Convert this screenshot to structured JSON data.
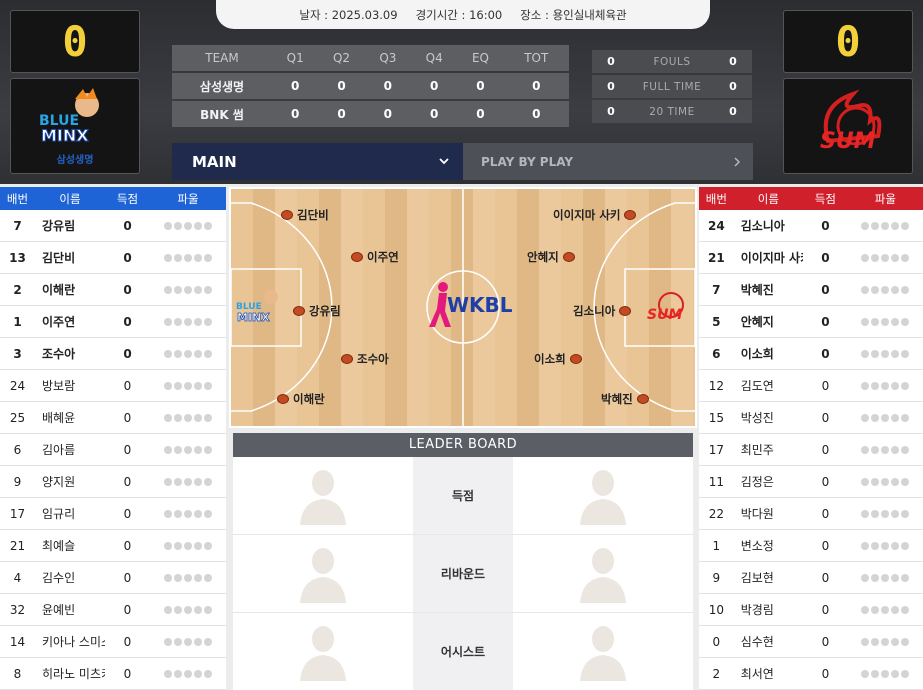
{
  "game_info": {
    "date": "날자 : 2025.03.09",
    "time": "경기시간 : 16:00",
    "venue": "장소 : 용인실내체육관"
  },
  "home": {
    "score": "0",
    "name": "삼성생명",
    "logo_text": "BLUE MINX"
  },
  "away": {
    "score": "0",
    "logo_text": "BNK SUM"
  },
  "quarter_table": {
    "headers": [
      "TEAM",
      "Q1",
      "Q2",
      "Q3",
      "Q4",
      "EQ",
      "TOT"
    ],
    "rows": [
      {
        "team": "삼성생명",
        "scores": [
          "0",
          "0",
          "0",
          "0",
          "0",
          "0"
        ]
      },
      {
        "team": "BNK 썸",
        "scores": [
          "0",
          "0",
          "0",
          "0",
          "0",
          "0"
        ]
      }
    ]
  },
  "stats": [
    {
      "label": "FOULS",
      "home": "0",
      "away": "0"
    },
    {
      "label": "FULL TIME",
      "home": "0",
      "away": "0"
    },
    {
      "label": "20 TIME",
      "home": "0",
      "away": "0"
    }
  ],
  "tabs": {
    "main": "MAIN",
    "pbp": "PLAY BY PLAY",
    "main_icon": "chevron-down-icon",
    "pbp_icon": "chevron-right-icon"
  },
  "roster_headers": [
    "배번",
    "이름",
    "득점",
    "파울"
  ],
  "home_roster": [
    {
      "no": "7",
      "name": "강유림",
      "pts": "0",
      "starter": true
    },
    {
      "no": "13",
      "name": "김단비",
      "pts": "0",
      "starter": true
    },
    {
      "no": "2",
      "name": "이해란",
      "pts": "0",
      "starter": true
    },
    {
      "no": "1",
      "name": "이주연",
      "pts": "0",
      "starter": true
    },
    {
      "no": "3",
      "name": "조수아",
      "pts": "0",
      "starter": true
    },
    {
      "no": "24",
      "name": "방보람",
      "pts": "0",
      "starter": false
    },
    {
      "no": "25",
      "name": "배혜윤",
      "pts": "0",
      "starter": false
    },
    {
      "no": "6",
      "name": "김아름",
      "pts": "0",
      "starter": false
    },
    {
      "no": "9",
      "name": "양지원",
      "pts": "0",
      "starter": false
    },
    {
      "no": "17",
      "name": "임규리",
      "pts": "0",
      "starter": false
    },
    {
      "no": "21",
      "name": "최예슬",
      "pts": "0",
      "starter": false
    },
    {
      "no": "4",
      "name": "김수인",
      "pts": "0",
      "starter": false
    },
    {
      "no": "32",
      "name": "윤예빈",
      "pts": "0",
      "starter": false
    },
    {
      "no": "14",
      "name": "키아나 스미스",
      "pts": "0",
      "starter": false
    },
    {
      "no": "8",
      "name": "히라노 미츠키",
      "pts": "0",
      "starter": false
    }
  ],
  "away_roster": [
    {
      "no": "24",
      "name": "김소니아",
      "pts": "0",
      "starter": true
    },
    {
      "no": "21",
      "name": "이이지마 사키",
      "pts": "0",
      "starter": true
    },
    {
      "no": "7",
      "name": "박혜진",
      "pts": "0",
      "starter": true
    },
    {
      "no": "5",
      "name": "안혜지",
      "pts": "0",
      "starter": true
    },
    {
      "no": "6",
      "name": "이소희",
      "pts": "0",
      "starter": true
    },
    {
      "no": "12",
      "name": "김도연",
      "pts": "0",
      "starter": false
    },
    {
      "no": "15",
      "name": "박성진",
      "pts": "0",
      "starter": false
    },
    {
      "no": "17",
      "name": "최민주",
      "pts": "0",
      "starter": false
    },
    {
      "no": "11",
      "name": "김정은",
      "pts": "0",
      "starter": false
    },
    {
      "no": "22",
      "name": "박다원",
      "pts": "0",
      "starter": false
    },
    {
      "no": "1",
      "name": "변소정",
      "pts": "0",
      "starter": false
    },
    {
      "no": "9",
      "name": "김보현",
      "pts": "0",
      "starter": false
    },
    {
      "no": "10",
      "name": "박경림",
      "pts": "0",
      "starter": false
    },
    {
      "no": "0",
      "name": "심수현",
      "pts": "0",
      "starter": false
    },
    {
      "no": "2",
      "name": "최서연",
      "pts": "0",
      "starter": false
    }
  ],
  "court": {
    "home_players": [
      "김단비",
      "이주연",
      "강유림",
      "조수아",
      "이해란"
    ],
    "away_players": [
      "이이지마 사키",
      "안혜지",
      "김소니아",
      "이소희",
      "박혜진"
    ],
    "center_logo": "WKBL"
  },
  "leader_board": {
    "title": "LEADER BOARD",
    "categories": [
      "득점",
      "리바운드",
      "어시스트"
    ]
  },
  "colors": {
    "home": "#1f64d6",
    "away": "#d0202c",
    "navy": "#202a4d"
  }
}
